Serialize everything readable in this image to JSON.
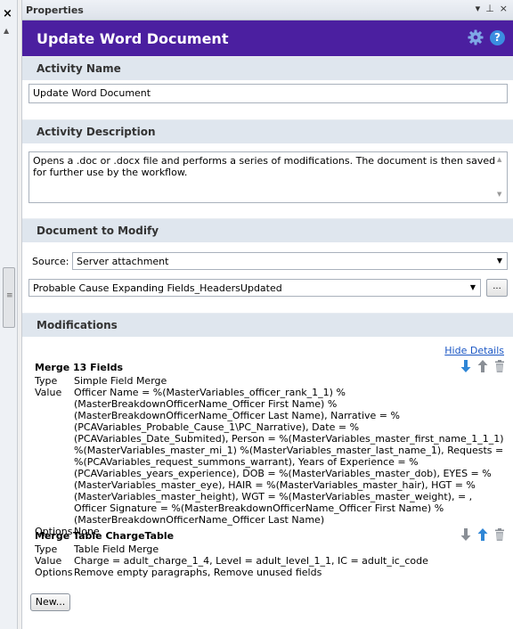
{
  "strip": {
    "close_glyph": "×",
    "scroll_up_glyph": "▲",
    "grip_glyph": "≡"
  },
  "titlebar": {
    "title": "Properties",
    "menu_glyph": "▾",
    "pin_glyph": "⊥",
    "close_glyph": "×"
  },
  "header": {
    "title": "Update Word Document",
    "gear_icon": "gear-icon",
    "help_icon": "help-icon",
    "help_glyph": "?"
  },
  "sections": {
    "name": "Activity Name",
    "description": "Activity Description",
    "document": "Document to Modify",
    "modifications": "Modifications"
  },
  "activity_name": {
    "value": "Update Word Document"
  },
  "activity_description": {
    "value": "Opens a .doc or .docx file and performs a series of modifications. The document is then saved for further use by the workflow."
  },
  "document": {
    "source_label": "Source:",
    "source_value": "Server attachment",
    "doc_value": "Probable Cause Expanding Fields_HeadersUpdated",
    "browse_label": "..."
  },
  "modifications": {
    "hide_details": "Hide Details",
    "items": [
      {
        "title": "Merge  13 Fields",
        "type_label": "Type",
        "type_value": "Simple Field Merge",
        "value_label": "Value",
        "value": "Officer Name = %(MasterVariables_officer_rank_1_1) %(MasterBreakdownOfficerName_Officer First Name) %(MasterBreakdownOfficerName_Officer Last Name), Narrative = %(PCAVariables_Probable_Cause_1\\PC_Narrative), Date = %(PCAVariables_Date_Submited), Person = %(MasterVariables_master_first_name_1_1_1) %(MasterVariables_master_mi_1) %(MasterVariables_master_last_name_1), Requests = %(PCAVariables_request_summons_warrant), Years of Experience = %(PCAVariables_years_experience), DOB = %(MasterVariables_master_dob), EYES = %(MasterVariables_master_eye), HAIR = %(MasterVariables_master_hair), HGT = %(MasterVariables_master_height), WGT = %(MasterVariables_master_weight),  = , Officer Signature = %(MasterBreakdownOfficerName_Officer First Name) %(MasterBreakdownOfficerName_Officer Last Name)",
        "options_label": "Options",
        "options_value": "None"
      },
      {
        "title": "Merge  Table ChargeTable",
        "type_label": "Type",
        "type_value": "Table Field Merge",
        "value_label": "Value",
        "value": "Charge = adult_charge_1_4, Level = adult_level_1_1, IC = adult_ic_code",
        "options_label": "Options",
        "options_value": "Remove empty paragraphs, Remove unused fields"
      }
    ],
    "new_button": "New..."
  },
  "colors": {
    "header_bg": "#4b1fa0",
    "section_bg": "#dfe6ee",
    "link": "#1a56c4",
    "arrow_blue": "#2f86d6",
    "arrow_gray": "#8a8f96"
  }
}
